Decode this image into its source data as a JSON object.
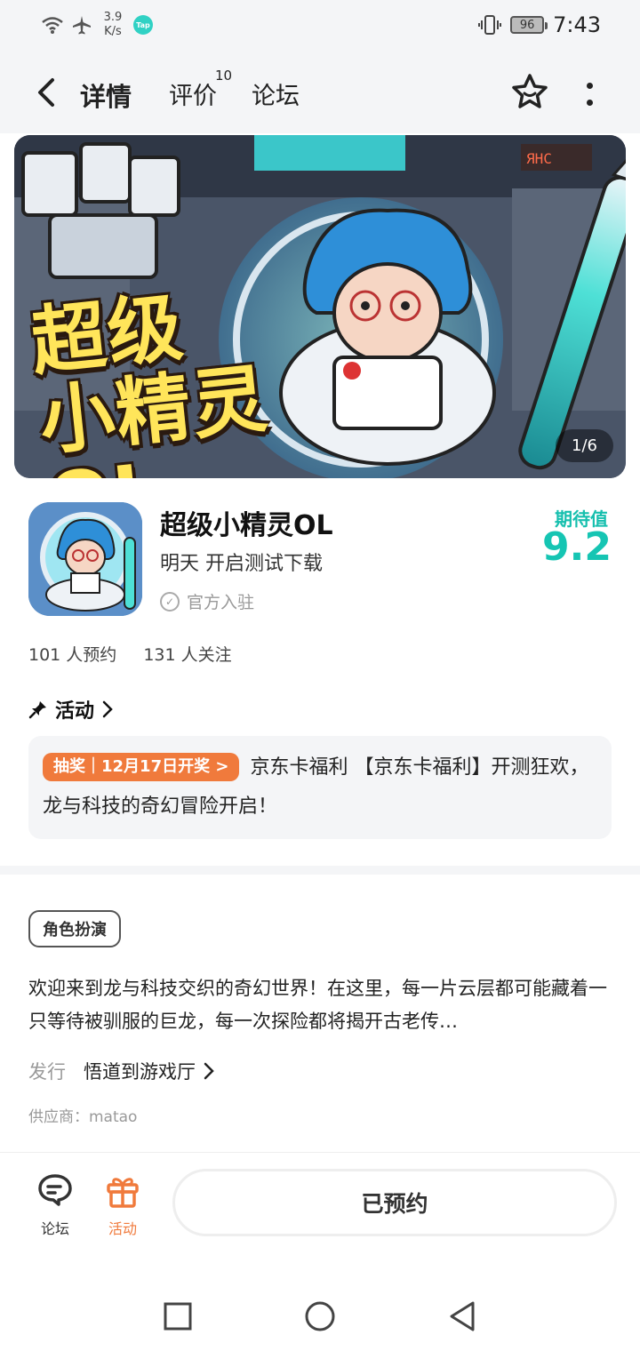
{
  "status_bar": {
    "speed_value": "3.9",
    "speed_unit": "K/s",
    "tap_badge": "Tap",
    "battery": "96",
    "time": "7:43"
  },
  "header": {
    "tabs": [
      {
        "label": "详情",
        "active": true
      },
      {
        "label": "评价",
        "badge": "10"
      },
      {
        "label": "论坛"
      }
    ]
  },
  "banner": {
    "title_line1": "超级",
    "title_line2": "小精灵OL",
    "counter": "1/6"
  },
  "game": {
    "name": "超级小精灵OL",
    "subtitle": "明天 开启测试下载",
    "official": "官方入驻",
    "expect_label": "期待值",
    "expect_score": "9.2",
    "reservations": "101 人预约",
    "followers": "131 人关注"
  },
  "activity": {
    "heading": "活动",
    "tag": "抽奖｜12月17日开奖 >",
    "text": "京东卡福利 【京东卡福利】开测狂欢，龙与科技的奇幻冒险开启！"
  },
  "detail": {
    "genre": "角色扮演",
    "description": "欢迎来到龙与科技交织的奇幻世界！在这里，每一片云层都可能藏着一只等待被驯服的巨龙，每一次探险都将揭开古老传…",
    "publisher_label": "发行",
    "publisher": "悟道到游戏厅",
    "supplier": "供应商：matao"
  },
  "action_bar": {
    "forum_label": "论坛",
    "event_label": "活动",
    "reserved_label": "已预约"
  },
  "colors": {
    "accent": "#2bd5c4",
    "score": "#16c5b3",
    "activity_orange": "#f07a3c"
  }
}
